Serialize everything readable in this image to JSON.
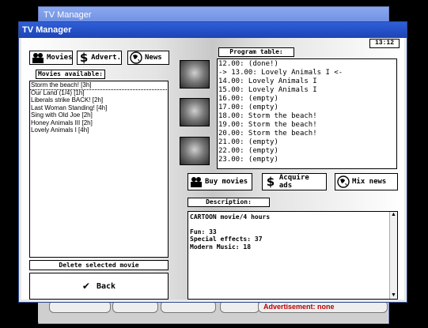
{
  "back_window": {
    "title": "TV Manager",
    "bottom_text": "Advertisement: none"
  },
  "window": {
    "title": "TV Manager",
    "clock": "13:12"
  },
  "tabs": {
    "movies": "Movies",
    "advert": "Advert.",
    "news": "News"
  },
  "movies_available": {
    "label": "Movies available:",
    "items": [
      "Storm the beach! [3h]",
      "Our Land (1/4) [1h]",
      "Liberals strike BACK! [2h]",
      "Last Woman Standing! [4h]",
      "Sing with Old Joe [2h]",
      "Honey Animals III [2h]",
      "Lovely Animals I [4h]"
    ]
  },
  "delete_label": "Delete selected movie",
  "back_label": "Back",
  "program": {
    "label": "Program table:",
    "items": [
      "12.00: (done!)",
      "-> 13.00: Lovely Animals I <-",
      "14.00: Lovely Animals I",
      "15.00: Lovely Animals I",
      "16.00: (empty)",
      "17.00: (empty)",
      "18.00: Storm the beach!",
      "19.00: Storm the beach!",
      "20.00: Storm the beach!",
      "21.00: (empty)",
      "22.00: (empty)",
      "23.00: (empty)"
    ]
  },
  "actions": {
    "buy": "Buy movies",
    "ads": "Acquire ads",
    "news": "Mix news"
  },
  "description": {
    "label": "Description:",
    "lines": [
      "CARTOON movie/4 hours",
      "",
      "Fun: 33",
      "Special effects: 37",
      "Modern Music: 18"
    ]
  }
}
